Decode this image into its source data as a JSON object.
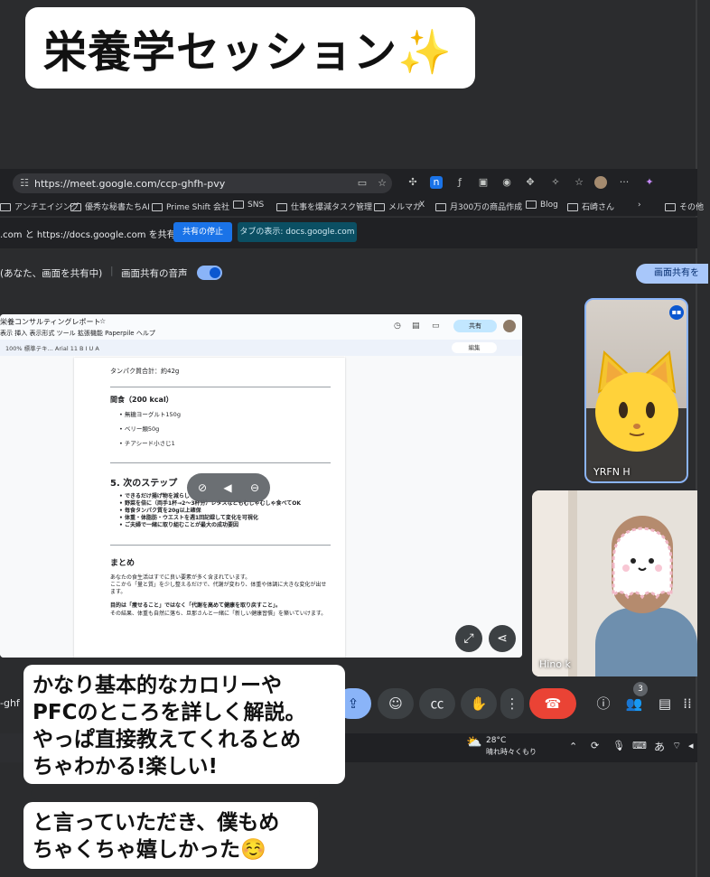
{
  "title_banner": {
    "text": "栄養学セッション✨"
  },
  "browser": {
    "url": "https://meet.google.com/ccp-ghfh-pvy",
    "bookmarks": [
      "アンチエイジング",
      "優秀な秘書たちAI",
      "Prime Shift 会社",
      "SNS",
      "仕事を爆減タスク管理",
      "メルマガ",
      "X",
      "月300万の商品作成",
      "Blog",
      "石崎さん",
      "その他"
    ],
    "share_message": ".com と https://docs.google.com を共有する",
    "stop_sharing_label": "共有の停止",
    "tab_show_label": "タブの表示: docs.google.com"
  },
  "meet": {
    "presenting_label": "(あなた、画面を共有中)",
    "audio_label": "画面共有の音声",
    "share_right_label": "画面共有を",
    "participants": [
      {
        "name": "YRFN H"
      },
      {
        "name": "Hino k"
      }
    ],
    "participant_count": "3",
    "left_meeting_code": "-ghf"
  },
  "doc": {
    "title": "栄養コンサルティングレポート",
    "menu": "表示  挿入  表示形式  ツール  拡張機能  Paperpile  ヘルプ",
    "toolbar": "100%   標準テキ...   Arial   11   B  I  U  A",
    "share_label": "共有",
    "edit_label": "編集",
    "protein_total": "タンパク質合計：約42g",
    "snack_heading": "間食（200 kcal）",
    "snack_items": [
      "無糖ヨーグルト150g",
      "ベリー類50g",
      "チアシード小さじ1"
    ],
    "next_steps_heading": "5. 次のステップ",
    "next_steps_items": [
      "できるだけ揚げ物を減らし",
      "野菜を倍に（両手1杯→2〜3杯分）レタスなどもむしゃむしゃ食べてOK",
      "毎食タンパク質を20g以上確保",
      "体重・体脂肪・ウエストを週1回記録して変化を可視化",
      "ご夫婦で一緒に取り組むことが最大の成功要因"
    ],
    "summary_heading": "まとめ",
    "summary_lines": [
      "あなたの食生活はすでに良い要素が多く含まれています。",
      "ここから「量と質」を少し整えるだけで、代謝が変わり、体重や体調に大きな変化が出せ",
      "ます。"
    ],
    "goal_line": "目的は「痩せること」ではなく「代謝を高めて健康を取り戻すこと」。",
    "result_line": "その結果、体重も自然に落ち、旦那さんと一緒に「新しい健康習慣」を築いていけます。"
  },
  "taskbar": {
    "temperature": "28°C",
    "weather": "晴れ時々くもり",
    "ime": "あ"
  },
  "captions": {
    "box1": [
      "かなり基本的なカロリーや",
      "PFCのところを詳しく解説。",
      "やっぱ直接教えてくれるとめ",
      "ちゃわかる!楽しい!"
    ],
    "box2": [
      "と言っていただき、僕もめ",
      "ちゃくちゃ嬉しかった☺️"
    ]
  }
}
